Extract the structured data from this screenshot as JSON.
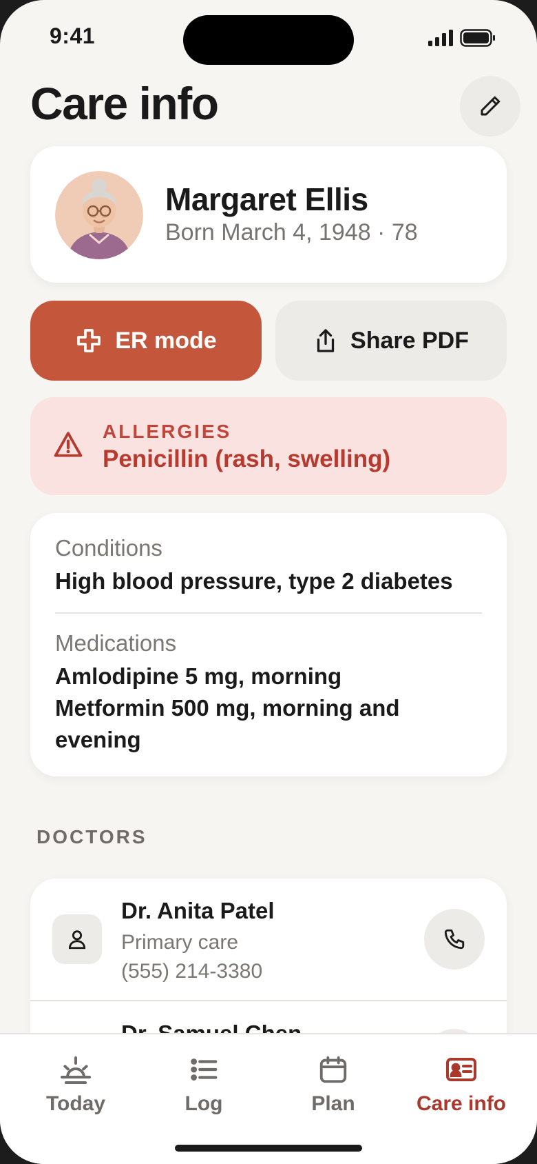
{
  "status": {
    "time": "9:41"
  },
  "header": {
    "title": "Care info",
    "edit_icon": "pencil-icon"
  },
  "profile": {
    "name": "Margaret Ellis",
    "born": "Born March 4, 1948 · 78"
  },
  "actions": {
    "er_label": "ER mode",
    "share_label": "Share PDF"
  },
  "allergies": {
    "label": "ALLERGIES",
    "value": "Penicillin (rash, swelling)"
  },
  "conditions": {
    "label": "Conditions",
    "value": "High blood pressure, type 2 diabetes"
  },
  "medications": {
    "label": "Medications",
    "lines": [
      "Amlodipine 5 mg, morning",
      "Metformin 500 mg, morning and evening"
    ]
  },
  "doctors": {
    "section_label": "DOCTORS",
    "items": [
      {
        "name": "Dr. Anita Patel",
        "role": "Primary care",
        "phone": "(555) 214-3380"
      },
      {
        "name": "Dr. Samuel Chen"
      }
    ]
  },
  "tabs": [
    {
      "label": "Today",
      "icon": "sunrise-icon"
    },
    {
      "label": "Log",
      "icon": "list-icon"
    },
    {
      "label": "Plan",
      "icon": "calendar-icon"
    },
    {
      "label": "Care info",
      "icon": "id-card-icon",
      "active": true
    }
  ],
  "colors": {
    "accent": "#c4573b",
    "active_tab": "#a8392c",
    "allergy_bg": "#f9e2e0",
    "allergy_text": "#b53a2f",
    "background": "#f6f5f2"
  }
}
